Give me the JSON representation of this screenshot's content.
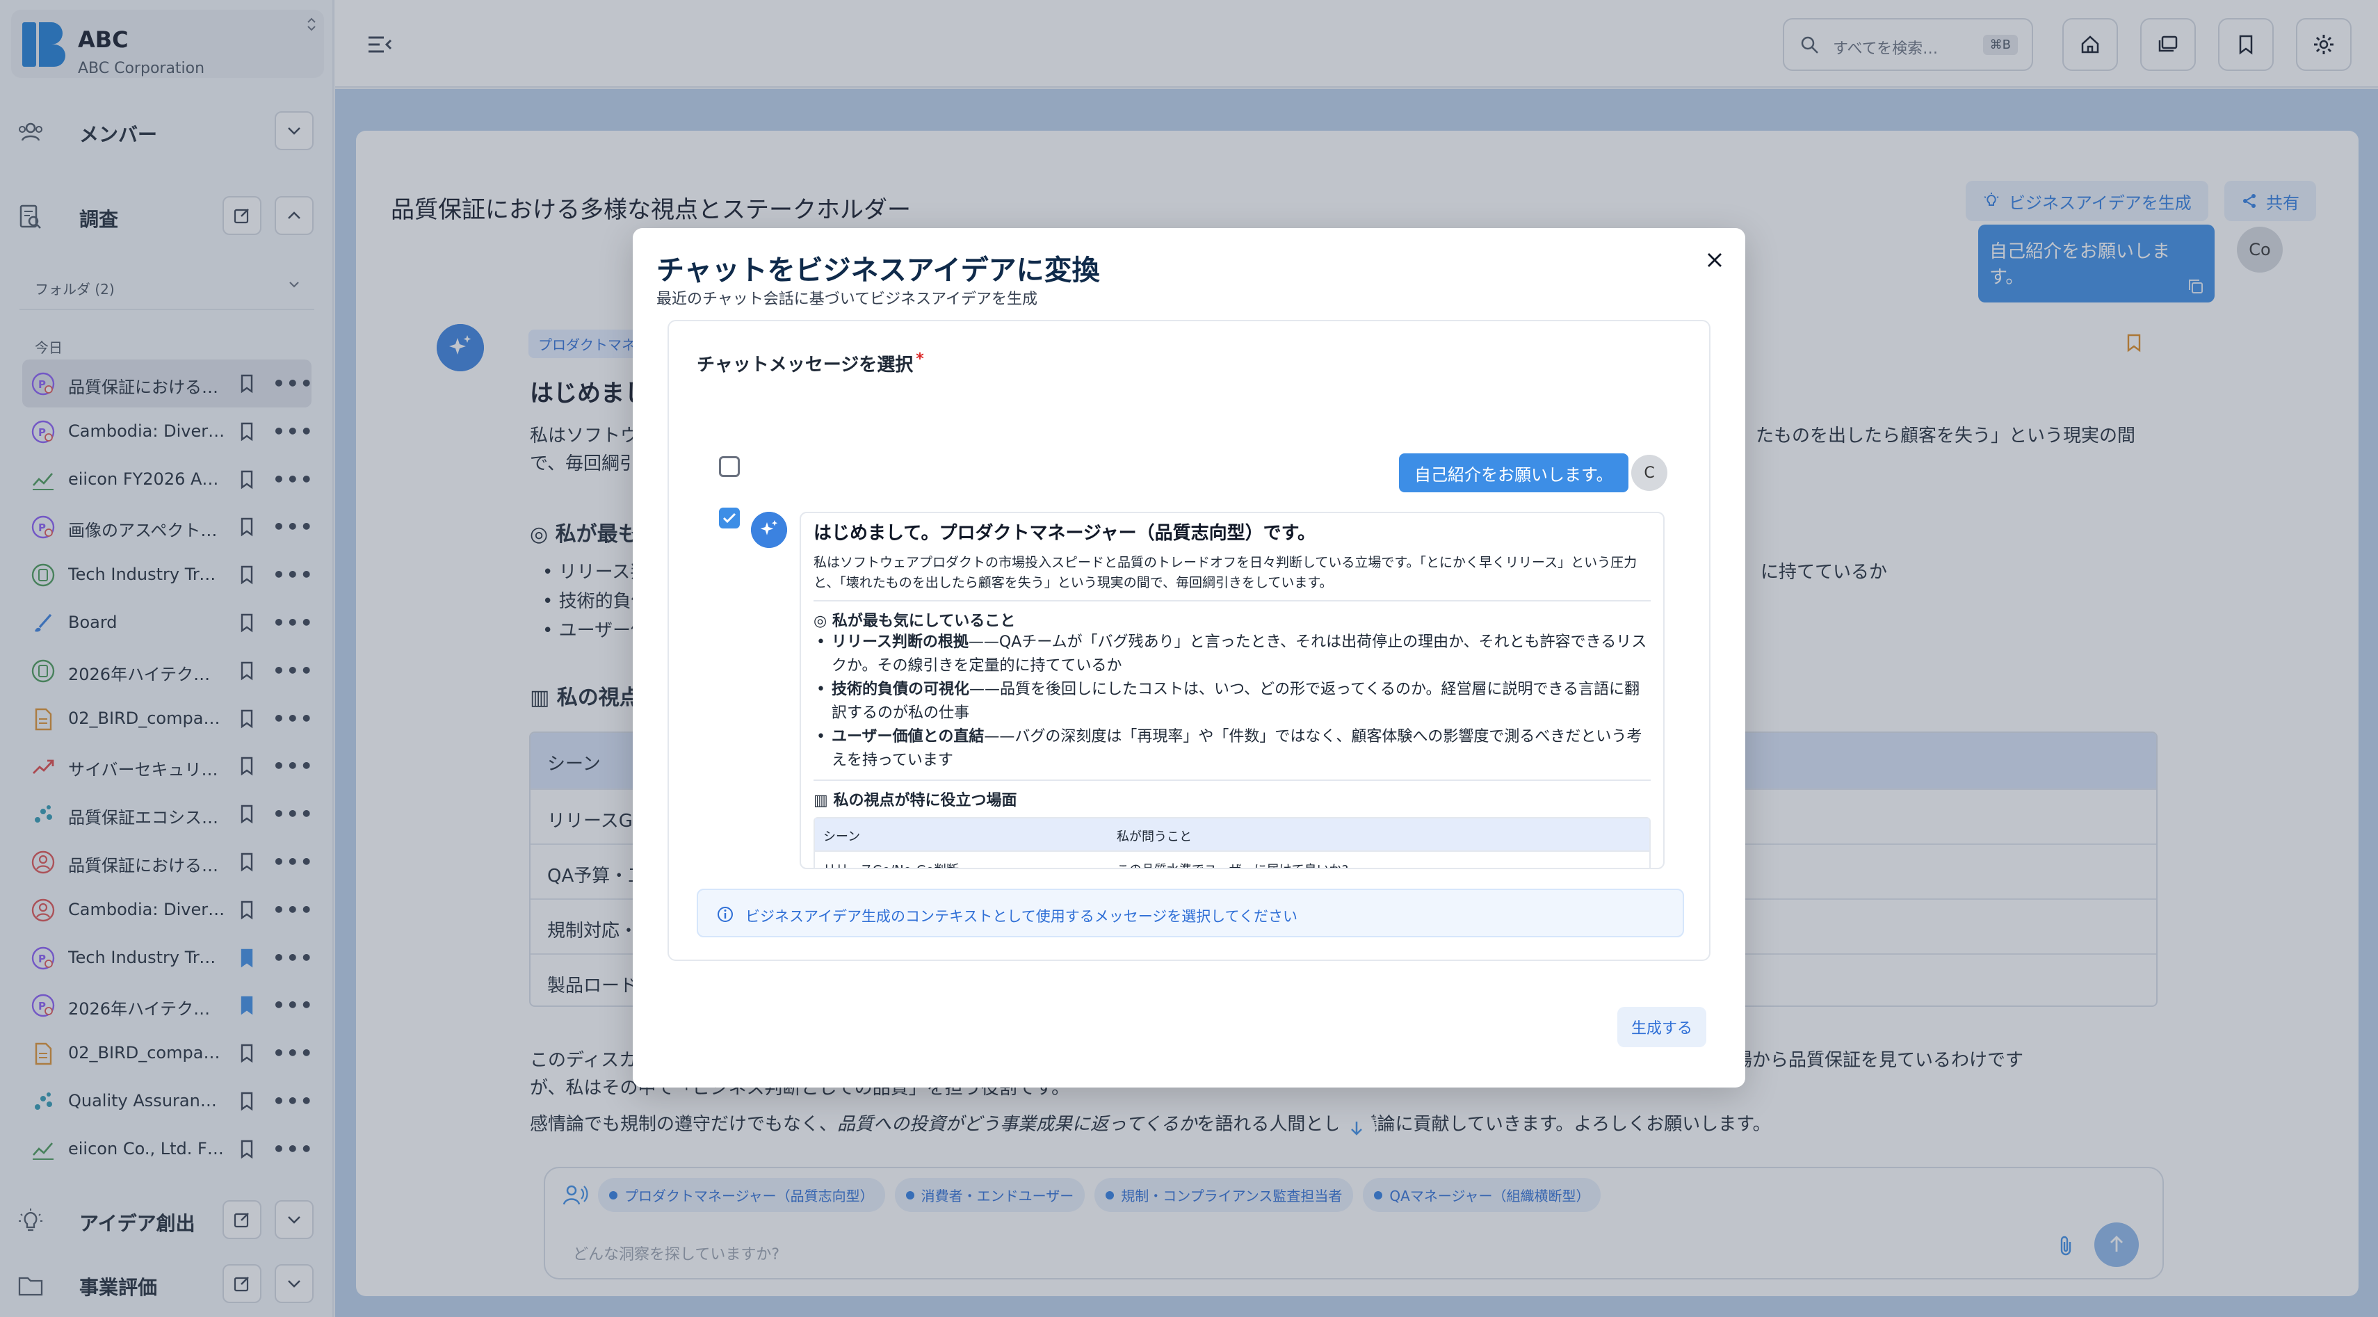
{
  "brand": {
    "name": "ABC",
    "sub": "ABC Corporation",
    "collapse_glyph": "⌃⌄"
  },
  "sidebar": {
    "members_label": "メンバー",
    "research_label": "調査",
    "folder_label": "フォルダ (2)",
    "day_label": "今日",
    "items": [
      {
        "label": "品質保証における多…",
        "icon": "persona-icon",
        "bookmarked": false,
        "active": true
      },
      {
        "label": "Cambodia: Diverse …",
        "icon": "persona-icon",
        "bookmarked": false
      },
      {
        "label": "eiicon FY2026 Anal…",
        "icon": "line-chart-icon",
        "bookmarked": false
      },
      {
        "label": "画像のアスペクト比…",
        "icon": "persona-icon",
        "bookmarked": false
      },
      {
        "label": "Tech Industry Trend…",
        "icon": "document-circle-icon",
        "bookmarked": false
      },
      {
        "label": "Board",
        "icon": "brush-icon",
        "bookmarked": false
      },
      {
        "label": "2026年ハイテク業…",
        "icon": "document-circle-icon",
        "bookmarked": false
      },
      {
        "label": "02_BIRD_company_…",
        "icon": "file-icon",
        "bookmarked": false
      },
      {
        "label": "サイバーセキュリティ",
        "icon": "trend-icon",
        "bookmarked": false
      },
      {
        "label": "品質保証エコシステ…",
        "icon": "scatter-icon",
        "bookmarked": false
      },
      {
        "label": "品質保証における多…",
        "icon": "user-circle-icon",
        "bookmarked": false
      },
      {
        "label": "Cambodia: Diverse …",
        "icon": "user-circle-icon",
        "bookmarked": false
      },
      {
        "label": "Tech Industry Trend…",
        "icon": "persona-icon",
        "bookmarked": true
      },
      {
        "label": "2026年ハイテク業…",
        "icon": "persona-icon",
        "bookmarked": true
      },
      {
        "label": "02_BIRD_company_…",
        "icon": "file-icon",
        "bookmarked": false
      },
      {
        "label": "Quality Assurance …",
        "icon": "scatter-icon",
        "bookmarked": false
      },
      {
        "label": "eiicon Co., Ltd. FY2…",
        "icon": "line-chart-icon",
        "bookmarked": false
      }
    ],
    "ideation_label": "アイデア創出",
    "evaluation_label": "事業評価"
  },
  "topbar": {
    "search_placeholder": "すべてを検索…",
    "search_shortcut": "⌘B"
  },
  "main": {
    "title": "品質保証における多様な視点とステークホルダー",
    "biz_button": "ビジネスアイデアを生成",
    "share_button": "共有",
    "user_message": "自己紹介をお願いします。",
    "user_avatar": "Co",
    "persona_tag": "プロダクトマネ",
    "heading": "はじめまし",
    "para1_left": "私はソフトウェ",
    "para1_right": "たものを出したら顧客を失う」という現実の間",
    "para1_line2": "で、毎回綱引き",
    "section1": "私が最も気",
    "bullets_left": [
      "リリース判",
      "技術的負債",
      "ユーザー価"
    ],
    "bullet1_right": "に持てているか",
    "section2": "私の視点が",
    "table_header": "シーン",
    "table_rows": [
      "リリースGo/I",
      "QA予算・工数",
      "規制対応・監",
      "製品ロードマ"
    ],
    "closing_left": "このディスカッ",
    "closing_right": "ぞれの立場から品質保証を見ているわけです",
    "closing_line2": "が、私はその中で「ビジネス判断としての品質」を担う役割です。",
    "closing_line3_a": "感情論でも規制の遵守だけでもなく、",
    "closing_line3_em": "品質への投資がどう事業成果に返ってくるか",
    "closing_line3_b": "を語れる人間として議論に貢献していきます。よろしくお願いします。",
    "chips": [
      "プロダクトマネージャー（品質志向型）",
      "消費者・エンドユーザー",
      "規制・コンプライアンス監査担当者",
      "QAマネージャー（組織横断型）"
    ],
    "chat_placeholder": "どんな洞察を探していますか?"
  },
  "modal": {
    "title": "チャットをビジネスアイデアに変換",
    "subtitle": "最近のチャット会話に基づいてビジネスアイデアを生成",
    "select_label": "チャットメッセージを選択",
    "required_mark": "*",
    "user_message": "自己紹介をお願いします。",
    "user_avatar": "C",
    "user_checked": false,
    "ai_checked": true,
    "preview": {
      "heading": "はじめまして。プロダクトマネージャー（品質志向型）です。",
      "intro": "私はソフトウェアプロダクトの市場投入スピードと品質のトレードオフを日々判断している立場です。「とにかく早くリリース」という圧力と、「壊れたものを出したら顧客を失う」という現実の間で、毎回綱引きをしています。",
      "section1": "私が最も気にしていること",
      "bullets": [
        {
          "bold": "リリース判断の根拠",
          "text": "——QAチームが「バグ残あり」と言ったとき、それは出荷停止の理由か、それとも許容できるリスクか。その線引きを定量的に持てているか"
        },
        {
          "bold": "技術的負債の可視化",
          "text": "——品質を後回しにしたコストは、いつ、どの形で返ってくるのか。経営層に説明できる言語に翻訳するのが私の仕事"
        },
        {
          "bold": "ユーザー価値との直結",
          "text": "——バグの深刻度は「再現率」や「件数」ではなく、顧客体験への影響度で測るべきだという考えを持っています"
        }
      ],
      "section2": "私の視点が特に役立つ場面",
      "table": {
        "headers": [
          "シーン",
          "私が問うこと"
        ],
        "rows": [
          [
            "リリースGo/No-Go判断",
            "この品質水準でユーザーに届けて良いか?"
          ]
        ]
      }
    },
    "info_text": "ビジネスアイデア生成のコンテキストとして使用するメッセージを選択してください",
    "generate_button": "生成する"
  },
  "colors": {
    "accent": "#3d8ee6",
    "accent_light": "#e8f0fb",
    "overlay": "#465266"
  }
}
